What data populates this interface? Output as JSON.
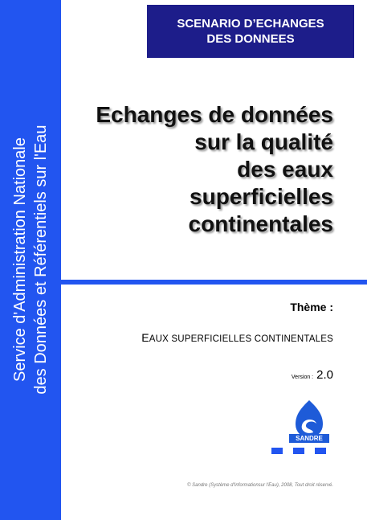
{
  "header": {
    "badge_line1": "SCENARIO D’ECHANGES",
    "badge_line2": "DES DONNEES"
  },
  "sidebar": {
    "line1": "Service d'Administration Nationale",
    "line2": "des Données et Référentiels sur l'Eau"
  },
  "title": {
    "line1": "Echanges de données",
    "line2": "sur la qualité",
    "line3": "des eaux",
    "line4": "superficielles",
    "line5": "continentales"
  },
  "theme": {
    "label": "Thème :",
    "value_first": "E",
    "value_rest": "AUX SUPERFICIELLES CONTINENTALES"
  },
  "version": {
    "label": "Version :",
    "number": "2.0"
  },
  "logo": {
    "text": "SANDRE",
    "icon": "sandre-logo-icon",
    "color": "#1e5bd8"
  },
  "footer": {
    "copyright": "© Sandre (Système d'Informationsur l'Eau), 2008, Tout droit réservé."
  },
  "colors": {
    "sidebar": "#2255f0",
    "badge": "#1d1d8a",
    "rule": "#2255f0"
  }
}
